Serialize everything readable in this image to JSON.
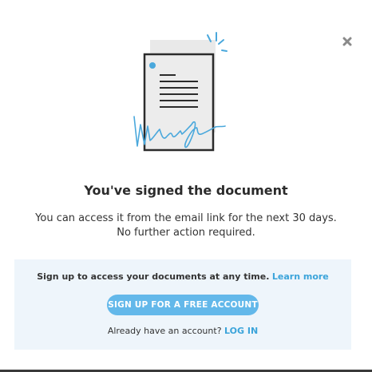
{
  "modal": {
    "title": "You've signed the document",
    "description_line1": "You can access it from the email link for the next 30 days.",
    "description_line2": "No further action required.",
    "close_icon": "close-icon"
  },
  "promo": {
    "text": "Sign up to access your documents at any time.",
    "learn_more_label": "Learn more",
    "cta_label": "SIGN UP FOR A FREE ACCOUNT",
    "account_prompt": "Already have an account?",
    "login_label": "LOG IN"
  },
  "colors": {
    "accent": "#3ba4da",
    "button": "#63b8ea",
    "promo_background": "#eef5fb",
    "text": "#333333"
  },
  "icons": {
    "illustration": "signed-document-icon"
  }
}
